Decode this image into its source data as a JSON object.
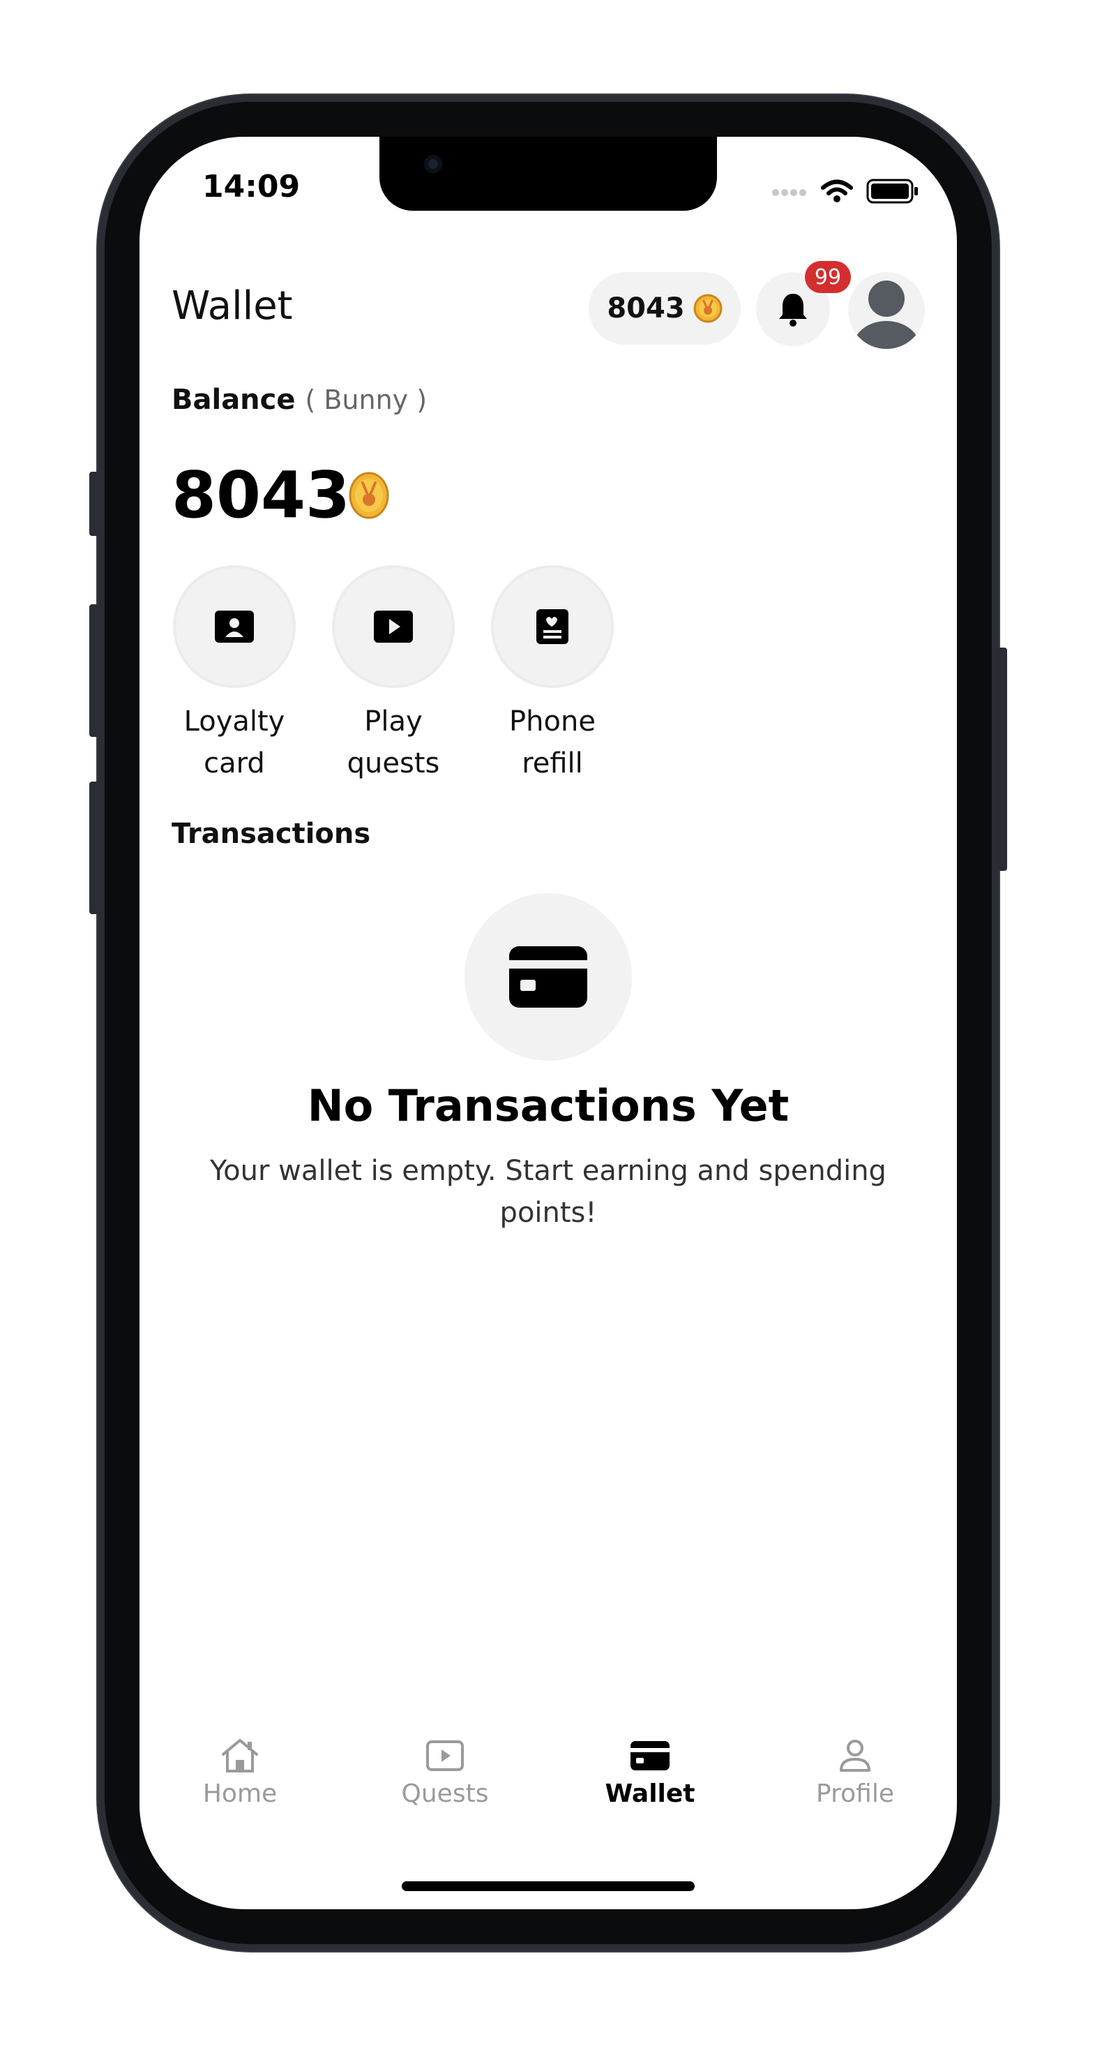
{
  "status_bar": {
    "time": "14:09"
  },
  "header": {
    "title": "Wallet",
    "points": "8043",
    "notification_count": "99"
  },
  "balance": {
    "label": "Balance",
    "currency": "( Bunny )",
    "amount": "8043"
  },
  "actions": [
    {
      "label": "Loyalty\ncard",
      "icon": "id-card-icon"
    },
    {
      "label": "Play\nquests",
      "icon": "play-icon"
    },
    {
      "label": "Phone\nrefill",
      "icon": "phone-card-icon"
    }
  ],
  "transactions": {
    "title": "Transactions",
    "empty_title": "No Transactions Yet",
    "empty_message": "Your wallet is empty. Start earning and spending points!"
  },
  "tabs": [
    {
      "label": "Home",
      "icon": "home-icon",
      "active": false
    },
    {
      "label": "Quests",
      "icon": "play-square-icon",
      "active": false
    },
    {
      "label": "Wallet",
      "icon": "card-icon",
      "active": true
    },
    {
      "label": "Profile",
      "icon": "person-icon",
      "active": false
    }
  ],
  "colors": {
    "accent": "#000000",
    "badge": "#d32f2f",
    "coin": "#f2b632",
    "muted": "#9a9a9a",
    "chip_bg": "#f2f2f2"
  }
}
